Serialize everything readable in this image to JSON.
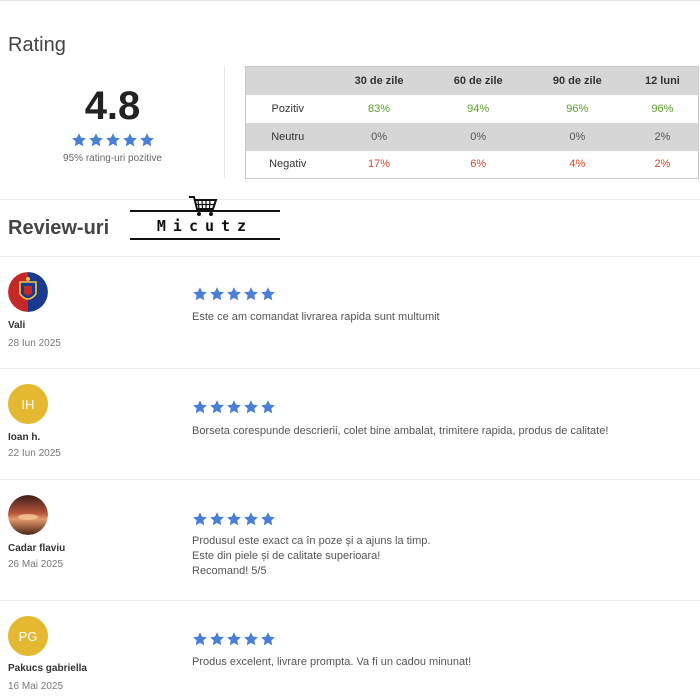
{
  "rating": {
    "title": "Rating",
    "score": "4.8",
    "stars": 5,
    "subtitle": "95% rating-uri pozitive",
    "star_color": "#4a7fd6",
    "table": {
      "headers": [
        "",
        "30 de zile",
        "60 de zile",
        "90 de zile",
        "12 luni"
      ],
      "rows": [
        {
          "label": "Pozitiv",
          "values": [
            "83%",
            "94%",
            "96%",
            "96%"
          ],
          "color": "#5a9e2a"
        },
        {
          "label": "Neutru",
          "values": [
            "0%",
            "0%",
            "0%",
            "2%"
          ],
          "color": "#555555"
        },
        {
          "label": "Negativ",
          "values": [
            "17%",
            "6%",
            "4%",
            "2%"
          ],
          "color": "#d24a2e"
        }
      ]
    }
  },
  "reviews": {
    "title": "Review-uri",
    "logo_text": "Micutz",
    "items": [
      {
        "name": "Vali",
        "date": "28 Iun 2025",
        "stars": 5,
        "avatar": "fcsb-logo",
        "lines": [
          "Este ce am comandat livrarea rapida sunt multumit"
        ]
      },
      {
        "name": "Ioan h.",
        "date": "22 Iun 2025",
        "stars": 5,
        "avatar_initials": "IH",
        "lines": [
          "Borseta corespunde descrierii, colet bine ambalat, trimitere rapida, produs de calitate!"
        ]
      },
      {
        "name": "Cadar flaviu",
        "date": "26 Mai 2025",
        "stars": 5,
        "avatar": "sunset-photo",
        "lines": [
          "Produsul este exact ca în poze și a ajuns la timp.",
          "Este din piele și de calitate superioara!",
          "Recomand! 5/5"
        ]
      },
      {
        "name": "Pakucs gabriella",
        "date": "16 Mai 2025",
        "stars": 5,
        "avatar_initials": "PG",
        "lines": [
          "Produs excelent, livrare prompta. Va fi un cadou minunat!"
        ]
      }
    ]
  }
}
